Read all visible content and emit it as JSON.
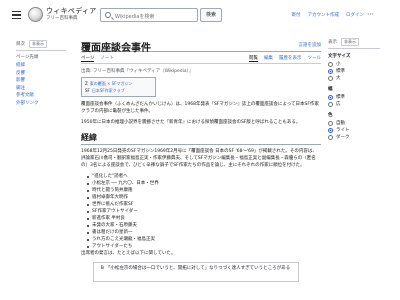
{
  "header": {
    "logo_title": "ウィキペディア",
    "logo_subtitle": "フリー百科事典",
    "search_placeholder": "Wikipediaを検索",
    "search_button": "検索",
    "top_links": [
      "寄付",
      "アカウント作成",
      "ログイン"
    ]
  },
  "sidebar": {
    "head": "目次",
    "hide": "非表示",
    "title": "ページ先頭",
    "items": [
      "経緯",
      "反響",
      "影響",
      "脚注",
      "参考文献",
      "外部リンク"
    ]
  },
  "article": {
    "title": "覆面座談会事件",
    "lang_button": "言語を追加",
    "tabs_left": [
      "ページ",
      "ノート"
    ],
    "tabs_right": [
      "閲覧",
      "編集",
      "履歴を表示",
      "ツール"
    ],
    "source": "出典: フリー百科事典『ウィキペディア（Wikipedia）』",
    "hatnote": [
      {
        "tag": "Z",
        "text": "東の覆面 × SFマガジン"
      },
      {
        "tag": "SF",
        "text": "日本SF作家クラブ"
      }
    ],
    "lead": "覆面座談会事件（ふくめんざだんかいじけん）は、1968年発表『SFマガジン』誌上の覆面座談会によって日本SF作家クラブの内部に亀裂が生じた事件。",
    "lead2": "1950年に日本の推理小説界を震撼させた『新青年』における探偵覆面座談会のSF版と呼ばれることもある。",
    "section_heading": "経緯",
    "section_para": "1968年12月25日発売のSFマガジン1969年2月号に「覆面座談会 日本のSF '68〜'69」が掲載された。その内容は、評論家石川喬司・翻訳家福島正実・作家伊藤典夫、そしてSFマガジン編集長・福島正実と副編集長・森優らの（匿名の）3名による座談会で、ひどく辛辣な調子でSF作家たちの作品を論じ、主にそれぞれの作家に順位を付けた。",
    "bullets": [
      "\"進化した\"読者へ",
      "小松左京 ── 九六〇、日本・世界",
      "時代と闘う筒井康隆",
      "眉村卓御年大明作",
      "世界に挑んだ作家SF",
      "SF作家アウトサイダー",
      "新進作家 半村良",
      "未発の大家・石原藤夫",
      "書は粗だけの星新一",
      "うれ方のこえ光瀬龍・福島正実",
      "アウトサイダーたち"
    ],
    "closing": "出席者の発言は、たとえば以下に関していた。",
    "quote": "Ｂ 「小松左京の場合は一口でいうと、開拓に対して」なりつづく達人すぎていうところがある"
  },
  "rightbar": {
    "head": "表示",
    "hide": "非表示",
    "text_section": "文字サイズ",
    "text_options": [
      "小",
      "標準",
      "大"
    ],
    "text_selected": 1,
    "width_section": "幅",
    "width_options": [
      "標準",
      "広"
    ],
    "width_selected": 0,
    "color_section": "色",
    "color_options": [
      "自動",
      "ライト",
      "ダーク"
    ],
    "color_selected": 1
  },
  "colors": {
    "link": "#3366cc",
    "text": "#202122",
    "border": "#a2a9b1"
  }
}
